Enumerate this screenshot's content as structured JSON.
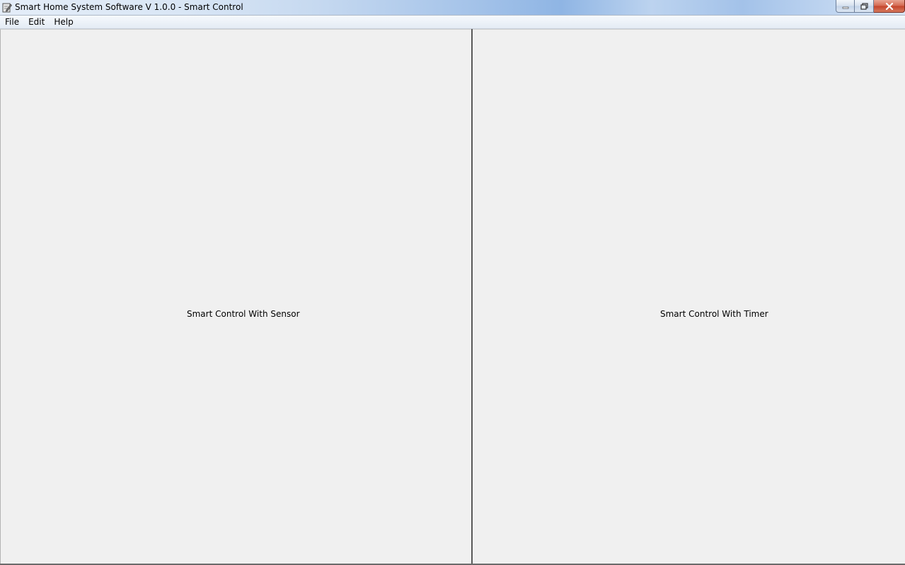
{
  "window": {
    "title": "Smart Home System Software V 1.0.0 - Smart Control",
    "icon": "app-edit-icon"
  },
  "menu": {
    "items": [
      {
        "label": "File"
      },
      {
        "label": "Edit"
      },
      {
        "label": "Help"
      }
    ]
  },
  "panels": {
    "left": {
      "label": "Smart Control With Sensor"
    },
    "right": {
      "label": "Smart Control With Timer"
    }
  },
  "colors": {
    "background": "#f0f0f0",
    "close_button": "#c4432a",
    "divider": "#5a5a5a"
  }
}
